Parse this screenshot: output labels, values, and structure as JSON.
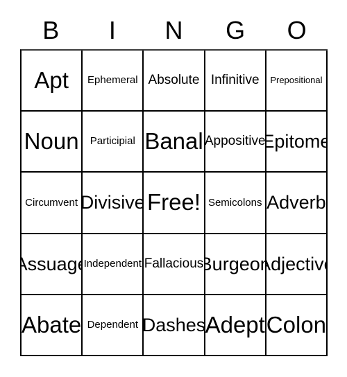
{
  "card": {
    "headers": [
      "B",
      "I",
      "N",
      "G",
      "O"
    ],
    "rows": [
      [
        {
          "label": "Apt",
          "size": "xl"
        },
        {
          "label": "Ephemeral",
          "size": "sm"
        },
        {
          "label": "Absolute",
          "size": "md"
        },
        {
          "label": "Infinitive",
          "size": "md"
        },
        {
          "label": "Prepositional",
          "size": "xs"
        }
      ],
      [
        {
          "label": "Noun",
          "size": "xl"
        },
        {
          "label": "Participial",
          "size": "sm"
        },
        {
          "label": "Banal",
          "size": "xl"
        },
        {
          "label": "Appositive",
          "size": "md"
        },
        {
          "label": "Epitome",
          "size": "lg"
        }
      ],
      [
        {
          "label": "Circumvent",
          "size": "sm"
        },
        {
          "label": "Divisive",
          "size": "lg"
        },
        {
          "label": "Free!",
          "size": "xl"
        },
        {
          "label": "Semicolons",
          "size": "sm"
        },
        {
          "label": "Adverb",
          "size": "lg"
        }
      ],
      [
        {
          "label": "Assuage",
          "size": "lg"
        },
        {
          "label": "Independent",
          "size": "sm"
        },
        {
          "label": "Fallacious",
          "size": "md"
        },
        {
          "label": "Burgeon",
          "size": "lg"
        },
        {
          "label": "Adjective",
          "size": "lg"
        }
      ],
      [
        {
          "label": "Abate",
          "size": "xl"
        },
        {
          "label": "Dependent",
          "size": "sm"
        },
        {
          "label": "Dashes",
          "size": "lg"
        },
        {
          "label": "Adept",
          "size": "xl"
        },
        {
          "label": "Colon",
          "size": "xl"
        }
      ]
    ],
    "colors": {
      "text": "#000000",
      "background": "#ffffff",
      "grid_line": "#000000"
    }
  }
}
